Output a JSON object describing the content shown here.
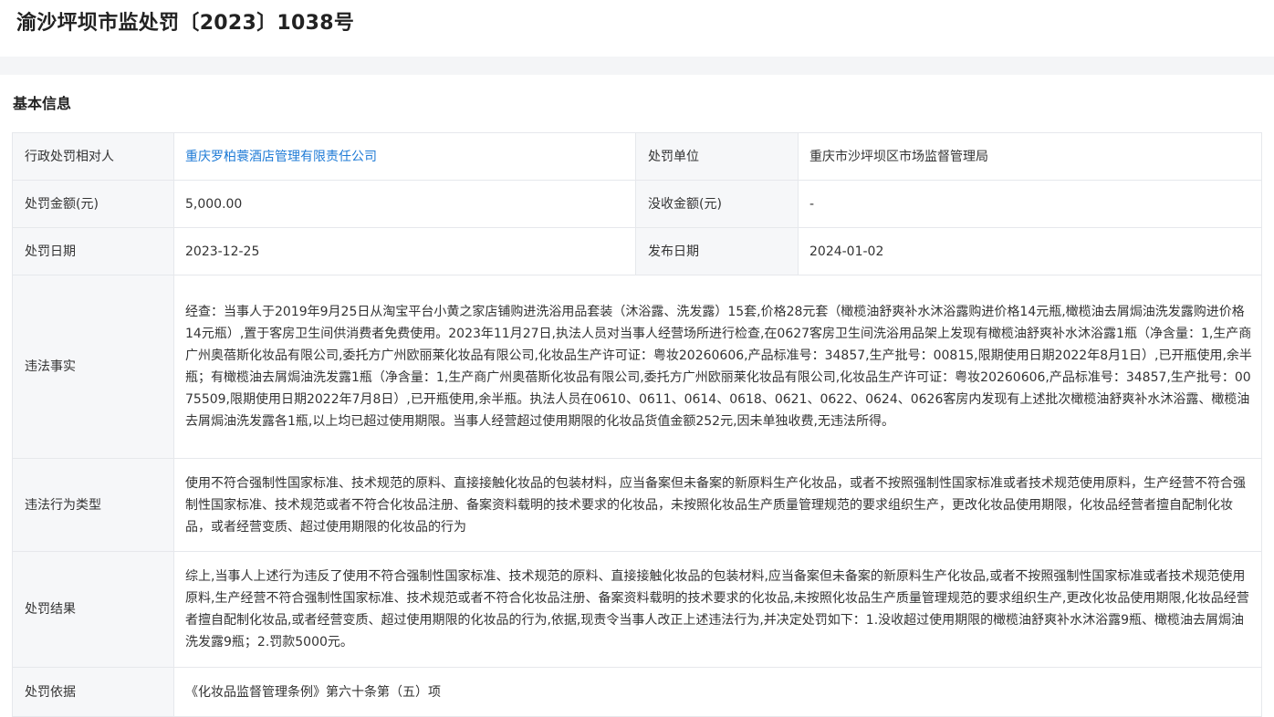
{
  "page": {
    "title": "渝沙坪坝市监处罚〔2023〕1038号",
    "section_title": "基本信息"
  },
  "colors": {
    "link": "#1f7bd6",
    "label_bg": "#f6f7f9",
    "border": "#e6e8ec",
    "band": "#f4f5f7"
  },
  "rows": {
    "party": {
      "label": "行政处罚相对人",
      "value": "重庆罗柏蓑酒店管理有限责任公司"
    },
    "unit": {
      "label": "处罚单位",
      "value": "重庆市沙坪坝区市场监督管理局"
    },
    "amount": {
      "label": "处罚金额(元)",
      "value": "5,000.00"
    },
    "confiscated": {
      "label": "没收金额(元)",
      "value": "-"
    },
    "penalty_date": {
      "label": "处罚日期",
      "value": "2023-12-25"
    },
    "publish_date": {
      "label": "发布日期",
      "value": "2024-01-02"
    },
    "facts": {
      "label": "违法事实",
      "value": "经查：当事人于2019年9月25日从淘宝平台小黄之家店铺购进洗浴用品套装（沐浴露、洗发露）15套,价格28元套（橄榄油舒爽补水沐浴露购进价格14元瓶,橄榄油去屑焗油洗发露购进价格14元瓶）,置于客房卫生间供消费者免费使用。2023年11月27日,执法人员对当事人经营场所进行检查,在0627客房卫生间洗浴用品架上发现有橄榄油舒爽补水沐浴露1瓶（净含量：1,生产商广州奥蓓斯化妆品有限公司,委托方广州欧丽莱化妆品有限公司,化妆品生产许可证：粤妆20260606,产品标准号：34857,生产批号：00815,限期使用日期2022年8月1日）,已开瓶使用,余半瓶；有橄榄油去屑焗油洗发露1瓶（净含量：1,生产商广州奥蓓斯化妆品有限公司,委托方广州欧丽莱化妆品有限公司,化妆品生产许可证：粤妆20260606,产品标准号：34857,生产批号：0075509,限期使用日期2022年7月8日）,已开瓶使用,余半瓶。执法人员在0610、0611、0614、0618、0621、0622、0624、0626客房内发现有上述批次橄榄油舒爽补水沐浴露、橄榄油去屑焗油洗发露各1瓶,以上均已超过使用期限。当事人经营超过使用期限的化妆品货值金额252元,因未单独收费,无违法所得。"
    },
    "violation_type": {
      "label": "违法行为类型",
      "value": "使用不符合强制性国家标准、技术规范的原料、直接接触化妆品的包装材料，应当备案但未备案的新原料生产化妆品，或者不按照强制性国家标准或者技术规范使用原料，生产经营不符合强制性国家标准、技术规范或者不符合化妆品注册、备案资料载明的技术要求的化妆品，未按照化妆品生产质量管理规范的要求组织生产，更改化妆品使用期限，化妆品经营者擅自配制化妆品，或者经营变质、超过使用期限的化妆品的行为"
    },
    "result": {
      "label": "处罚结果",
      "value": "综上,当事人上述行为违反了使用不符合强制性国家标准、技术规范的原料、直接接触化妆品的包装材料,应当备案但未备案的新原料生产化妆品,或者不按照强制性国家标准或者技术规范使用原料,生产经营不符合强制性国家标准、技术规范或者不符合化妆品注册、备案资料载明的技术要求的化妆品,未按照化妆品生产质量管理规范的要求组织生产,更改化妆品使用期限,化妆品经营者擅自配制化妆品,或者经营变质、超过使用期限的化妆品的行为,依据,现责令当事人改正上述违法行为,并决定处罚如下：1.没收超过使用期限的橄榄油舒爽补水沐浴露9瓶、橄榄油去屑焗油洗发露9瓶；2.罚款5000元。"
    },
    "basis": {
      "label": "处罚依据",
      "value": "《化妆品监督管理条例》第六十条第（五）项"
    }
  }
}
